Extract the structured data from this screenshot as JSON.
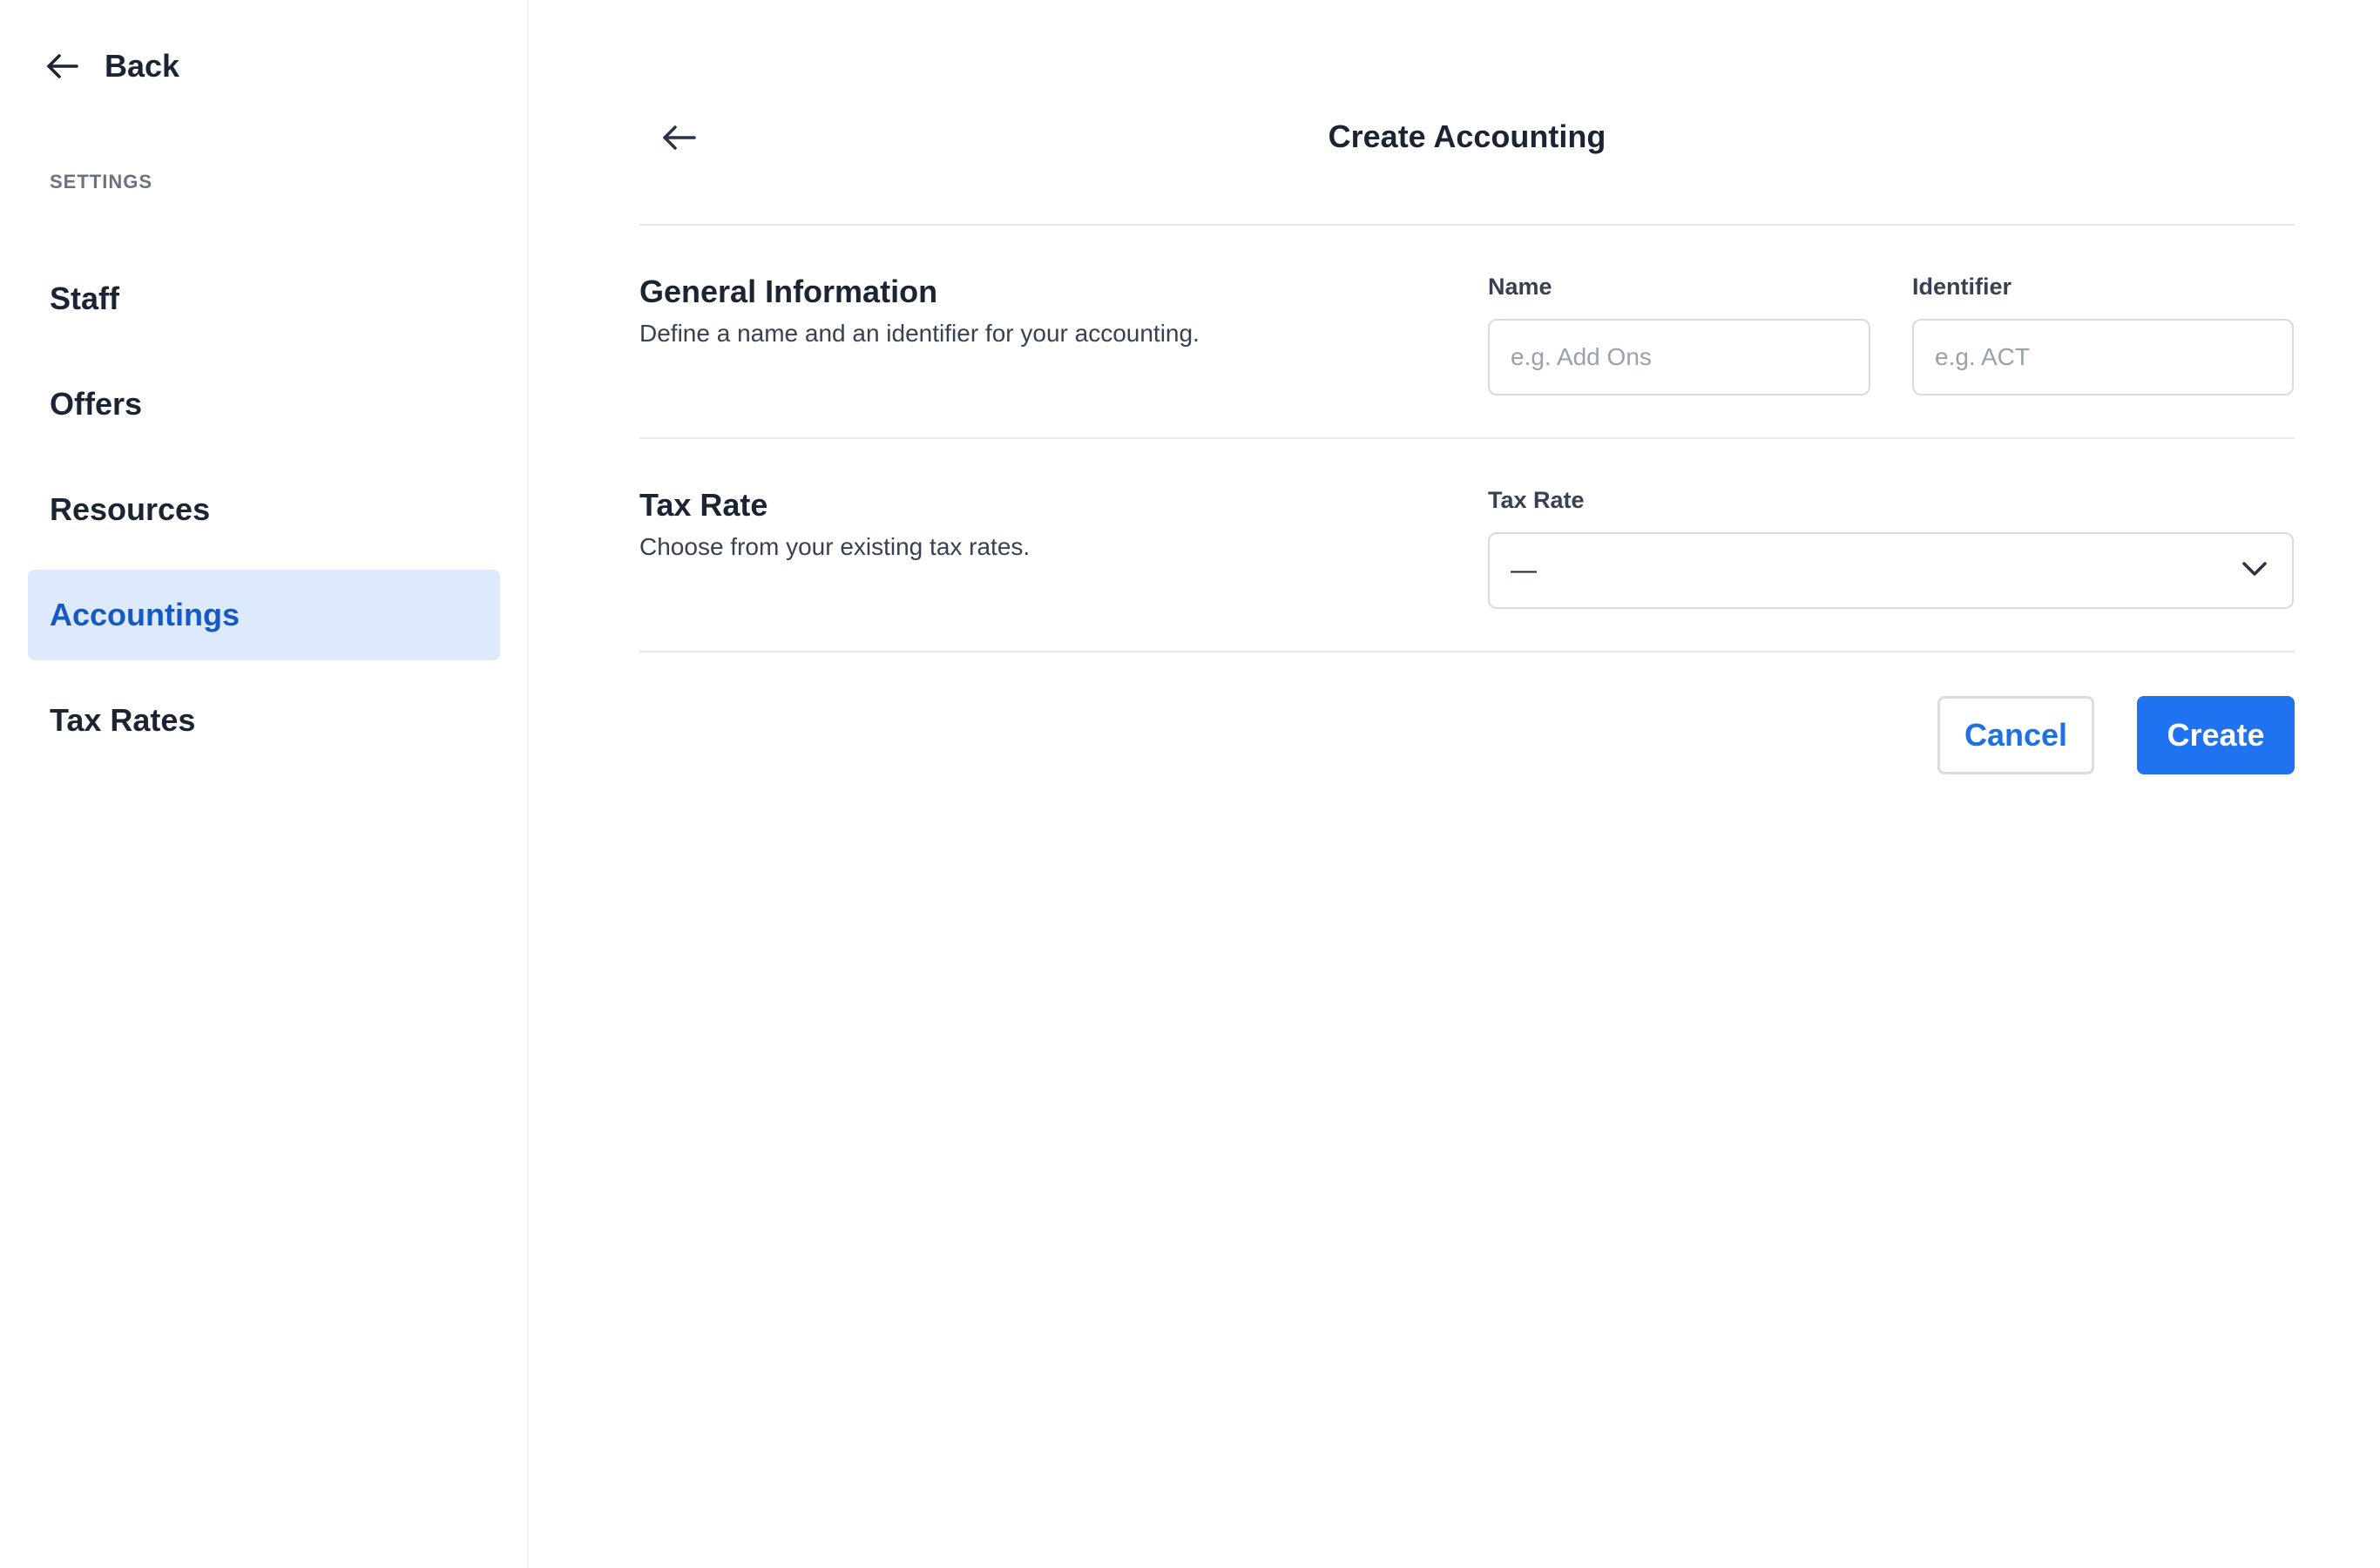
{
  "colors": {
    "accent": "#1f72f0",
    "active_nav_bg": "#dde9fc",
    "active_nav_text": "#1559c4"
  },
  "sidebar": {
    "back_label": "Back",
    "section_label": "SETTINGS",
    "items": [
      {
        "label": "Staff",
        "active": false
      },
      {
        "label": "Offers",
        "active": false
      },
      {
        "label": "Resources",
        "active": false
      },
      {
        "label": "Accountings",
        "active": true
      },
      {
        "label": "Tax Rates",
        "active": false
      }
    ]
  },
  "header": {
    "title": "Create Accounting",
    "back_icon": "arrow-left-icon"
  },
  "general": {
    "title": "General Information",
    "description": "Define a name and an identifier for your accounting.",
    "name_label": "Name",
    "name_value": "",
    "name_placeholder": "e.g. Add Ons",
    "identifier_label": "Identifier",
    "identifier_value": "",
    "identifier_placeholder": "e.g. ACT"
  },
  "tax": {
    "title": "Tax Rate",
    "description": "Choose from your existing tax rates.",
    "select_label": "Tax Rate",
    "selected_value": "—",
    "select_icon": "chevron-down-icon"
  },
  "actions": {
    "cancel_label": "Cancel",
    "create_label": "Create"
  }
}
